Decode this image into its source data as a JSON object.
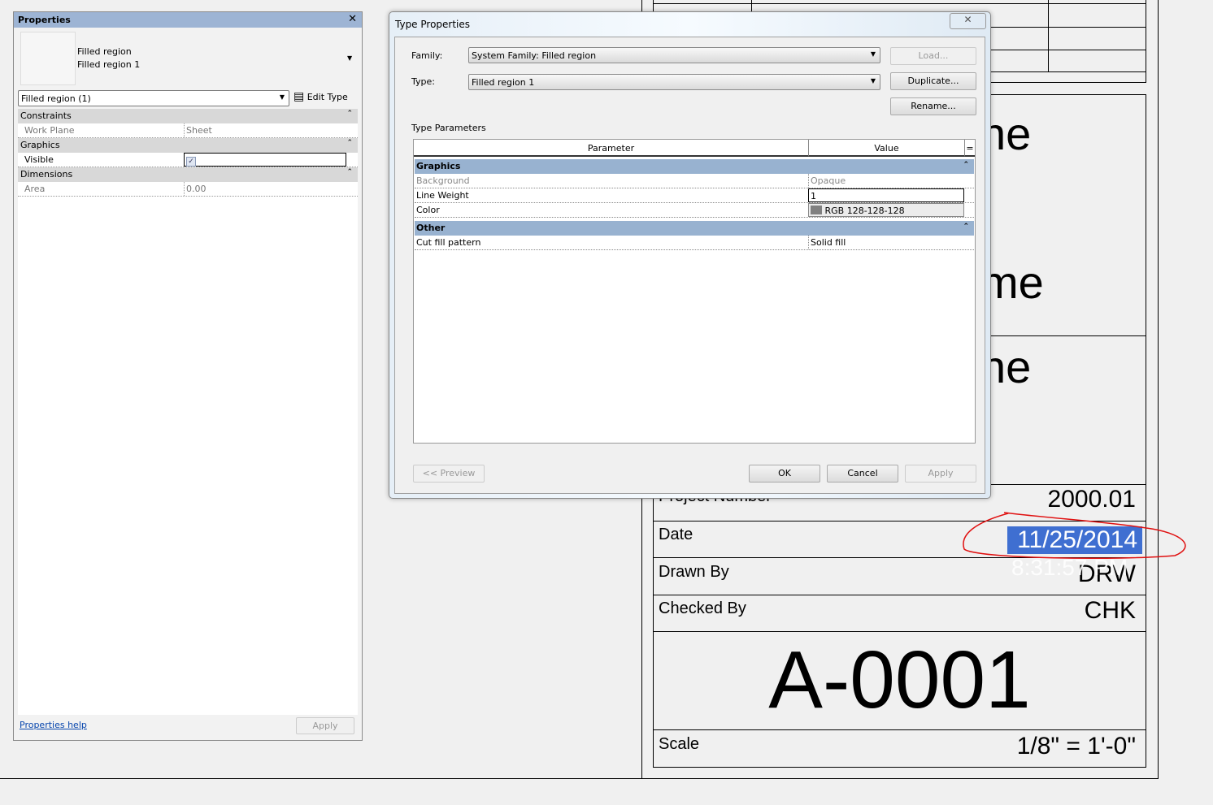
{
  "properties": {
    "title": "Properties",
    "family": "Filled region",
    "type": "Filled region 1",
    "selector": "Filled region (1)",
    "edit_type": "Edit Type",
    "groups": [
      {
        "name": "Constraints",
        "rows": [
          {
            "k": "Work Plane",
            "v": "Sheet"
          }
        ]
      },
      {
        "name": "Graphics",
        "rows": [
          {
            "k": "Visible",
            "v": "checked"
          }
        ]
      },
      {
        "name": "Dimensions",
        "rows": [
          {
            "k": "Area",
            "v": "0.00"
          }
        ]
      }
    ],
    "help": "Properties help",
    "apply": "Apply"
  },
  "dialog": {
    "title": "Type Properties",
    "family_label": "Family:",
    "family_value": "System Family: Filled region",
    "type_label": "Type:",
    "type_value": "Filled region 1",
    "load": "Load...",
    "duplicate": "Duplicate...",
    "rename": "Rename...",
    "type_params": "Type Parameters",
    "col_param": "Parameter",
    "col_value": "Value",
    "col_eq": "=",
    "g1": "Graphics",
    "r1k": "Background",
    "r1v": "Opaque",
    "r2k": "Line Weight",
    "r2v": "1",
    "r3k": "Color",
    "r3v": "RGB 128-128-128",
    "g2": "Other",
    "r4k": "Cut fill pattern",
    "r4v": "Solid fill",
    "preview": "<< Preview",
    "ok": "OK",
    "cancel": "Cancel",
    "apply": "Apply",
    "swatch_color": "#808080"
  },
  "titleblock": {
    "frag1": "ne",
    "frag2": "me",
    "frag3": "ne",
    "project_number_label": "Project Number",
    "project_number": "2000.01",
    "date_label": "Date",
    "date": "11/25/2014",
    "time": "8:31:57 PM",
    "drawn_label": "Drawn By",
    "drawn": "DRW",
    "checked_label": "Checked By",
    "checked": "CHK",
    "sheet_number": "A-0001",
    "scale_label": "Scale",
    "scale": "1/8\" = 1'-0\"",
    "highlight_color": "#3f6fd1",
    "annotation_color": "#e01010"
  }
}
